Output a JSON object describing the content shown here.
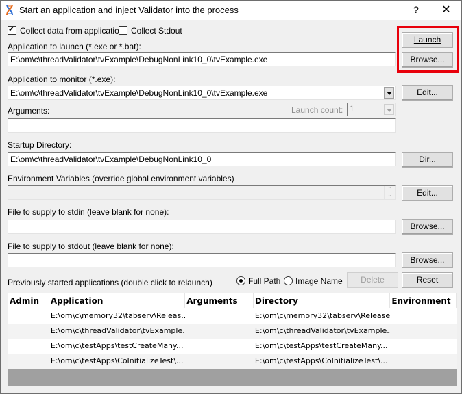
{
  "window": {
    "title": "Start an application and inject Validator into the process",
    "help_label": "?",
    "close_label": "✕",
    "icon": "dna-helix-icon",
    "highlight_color": "#e8000b"
  },
  "options": {
    "collect_data_label": "Collect data from application",
    "collect_data_checked": true,
    "collect_stdout_label": "Collect Stdout",
    "collect_stdout_checked": false
  },
  "launch": {
    "label": "Application to launch (*.exe or *.bat):",
    "value": "E:\\om\\c\\threadValidator\\tvExample\\DebugNonLink10_0\\tvExample.exe",
    "launch_button": "Launch",
    "browse_button": "Browse..."
  },
  "monitor": {
    "label": "Application to monitor (*.exe):",
    "value": "E:\\om\\c\\threadValidator\\tvExample\\DebugNonLink10_0\\tvExample.exe",
    "edit_button": "Edit..."
  },
  "arguments": {
    "label": "Arguments:",
    "value": "",
    "launch_count_label": "Launch count:",
    "launch_count_value": "1"
  },
  "startup_dir": {
    "label": "Startup Directory:",
    "value": "E:\\om\\c\\threadValidator\\tvExample\\DebugNonLink10_0",
    "dir_button": "Dir..."
  },
  "environment": {
    "label": "Environment Variables (override global environment variables)",
    "value": "",
    "edit_button": "Edit..."
  },
  "stdin": {
    "label": "File to supply to stdin (leave blank for none):",
    "value": "",
    "browse_button": "Browse..."
  },
  "stdout": {
    "label": "File to supply to stdout (leave blank for none):",
    "value": "",
    "browse_button": "Browse..."
  },
  "history": {
    "label": "Previously started applications (double click to relaunch)",
    "full_path_label": "Full Path",
    "full_path_selected": true,
    "image_name_label": "Image Name",
    "image_name_selected": false,
    "delete_button": "Delete",
    "reset_button": "Reset",
    "columns": [
      "Admin",
      "Application",
      "Arguments",
      "Directory",
      "Environment"
    ],
    "rows": [
      {
        "admin": "",
        "application": "E:\\om\\c\\memory32\\tabserv\\Releas...",
        "arguments": "",
        "directory": "E:\\om\\c\\memory32\\tabserv\\Release",
        "environment": ""
      },
      {
        "admin": "",
        "application": "E:\\om\\c\\threadValidator\\tvExample...",
        "arguments": "",
        "directory": "E:\\om\\c\\threadValidator\\tvExample...",
        "environment": ""
      },
      {
        "admin": "",
        "application": "E:\\om\\c\\testApps\\testCreateMany...",
        "arguments": "",
        "directory": "E:\\om\\c\\testApps\\testCreateMany...",
        "environment": ""
      },
      {
        "admin": "",
        "application": "E:\\om\\c\\testApps\\CoInitializeTest\\...",
        "arguments": "",
        "directory": "E:\\om\\c\\testApps\\CoInitializeTest\\...",
        "environment": ""
      }
    ]
  }
}
